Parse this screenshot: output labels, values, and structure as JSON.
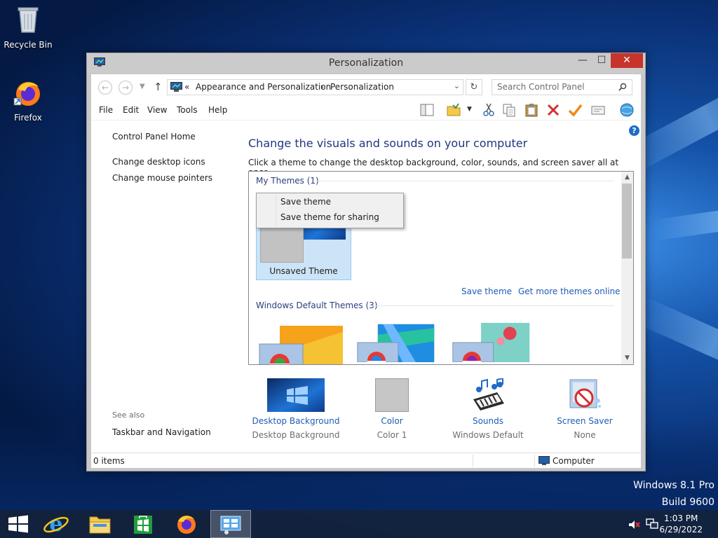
{
  "desktop": {
    "icons": [
      {
        "label": "Recycle Bin",
        "icon": "recycle-bin-icon"
      },
      {
        "label": "Firefox",
        "icon": "firefox-icon"
      }
    ],
    "watermark": {
      "edition": "Windows 8.1 Pro",
      "build": "Build 9600"
    }
  },
  "window": {
    "title": "Personalization",
    "controls": {
      "minimize": "—",
      "maximize": "☐",
      "close": "✕"
    },
    "address": {
      "overflow": "«",
      "crumbs": [
        "Appearance and Personalization",
        "Personalization"
      ],
      "separator": "›"
    },
    "search": {
      "placeholder": "Search Control Panel"
    },
    "menu": [
      "File",
      "Edit",
      "View",
      "Tools",
      "Help"
    ],
    "left_nav": {
      "home": "Control Panel Home",
      "links": [
        "Change desktop icons",
        "Change mouse pointers"
      ],
      "see_also_heading": "See also",
      "see_also_links": [
        "Taskbar and Navigation"
      ]
    },
    "main": {
      "title": "Change the visuals and sounds on your computer",
      "description": "Click a theme to change the desktop background, color, sounds, and screen saver all at once.",
      "my_themes_heading": "My Themes (1)",
      "unsaved_theme_label": "Unsaved Theme",
      "context_menu": [
        "Save theme",
        "Save theme for sharing"
      ],
      "links": {
        "save_theme": "Save theme",
        "get_more": "Get more themes online"
      },
      "default_themes_heading": "Windows Default Themes (3)"
    },
    "customize": [
      {
        "label": "Desktop Background",
        "value": "Desktop Background",
        "icon": "desktop-background-icon"
      },
      {
        "label": "Color",
        "value": "Color 1",
        "icon": "color-swatch-icon"
      },
      {
        "label": "Sounds",
        "value": "Windows Default",
        "icon": "sounds-icon"
      },
      {
        "label": "Screen Saver",
        "value": "None",
        "icon": "screen-saver-icon"
      }
    ],
    "status": {
      "items": "0 items",
      "location": "Computer"
    }
  },
  "taskbar": {
    "clock": {
      "time": "1:03 PM",
      "date": "6/29/2022"
    }
  }
}
